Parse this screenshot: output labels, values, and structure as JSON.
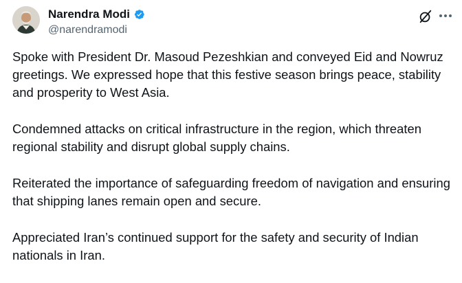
{
  "author": {
    "display_name": "Narendra Modi",
    "handle": "@narendramodi",
    "verified": true,
    "verified_color": "#1d9bf0"
  },
  "icons": {
    "verified": "verified-badge-icon",
    "grok": "grok-icon",
    "more": "more-options-icon"
  },
  "tweet": {
    "paragraphs": [
      "Spoke with President Dr. Masoud Pezeshkian and conveyed Eid and Nowruz greetings. We expressed hope that this festive season brings peace, stability and prosperity to West Asia.",
      "Condemned attacks on critical infrastructure in the region, which threaten regional stability and disrupt global supply chains.",
      "Reiterated the importance of safeguarding freedom of navigation and ensuring that shipping lanes remain open and secure.",
      "Appreciated Iran’s continued support for the safety and security of Indian nationals in Iran."
    ]
  }
}
